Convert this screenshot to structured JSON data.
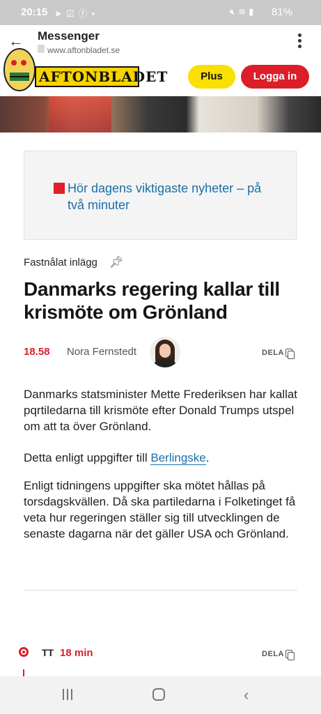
{
  "status_bar": {
    "time": "20:15",
    "left_icons": [
      "telegram-icon",
      "check-icon",
      "facebook-icon",
      "dot-icon"
    ],
    "right_icons": [
      "mute-icon",
      "wifi-icon",
      "signal-icon"
    ],
    "battery": "81%"
  },
  "custom_tab": {
    "title": "Messenger",
    "url": "www.aftonbladet.se"
  },
  "header": {
    "logo_text": "AFTONBLADET",
    "plus_label": "Plus",
    "login_label": "Logga in",
    "colors": {
      "plus_bg": "#f9e000",
      "login_bg": "#dc1e2a"
    }
  },
  "teaser": {
    "text": "Hör dagens viktigaste nyheter – på två minuter"
  },
  "post": {
    "pinned_label": "Fastnålat inlägg",
    "headline": "Danmarks regering kallar till krismöte om Grönland",
    "time": "18.58",
    "author": "Nora Fernstedt",
    "share_label": "DELA",
    "paragraphs": {
      "p1": "Danmarks statsminister Mette Frederiksen har kallat pqrtiledarna till krismöte efter Donald Trumps utspel om att ta över Grönland.",
      "p2_prefix": "Detta enligt uppgifter till ",
      "p2_link": "Berlingske",
      "p2_suffix": ".",
      "p3": "Enligt tidningens uppgifter ska mötet hållas på torsdagskvällen. Då ska partiledarna i Folketinget få veta hur regeringen ställer sig till utvecklingen de senaste dagarna när det gäller USA och Grönland."
    }
  },
  "next_post": {
    "source": "TT",
    "age": "18 min",
    "share_label": "DELA"
  }
}
